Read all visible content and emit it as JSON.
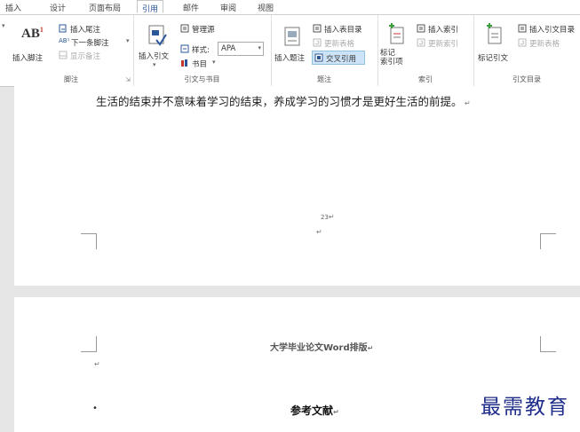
{
  "tabs": [
    "插入",
    "设计",
    "页面布局",
    "引用",
    "邮件",
    "审阅",
    "视图"
  ],
  "ribbon": {
    "footnotes": {
      "insert_footnote": "插入脚注",
      "insert_endnote": "插入尾注",
      "next_footnote": "下一条脚注",
      "show_notes": "显示备注",
      "group_label": "脚注"
    },
    "citations": {
      "insert_citation": "插入引文",
      "manage_sources": "管理源",
      "style_label": "样式:",
      "style_value": "APA",
      "bibliography": "书目",
      "group_label": "引文与书目"
    },
    "captions": {
      "insert_caption": "插入题注",
      "insert_table_of_figures": "插入表目录",
      "update_table": "更新表格",
      "cross_reference": "交叉引用",
      "group_label": "题注"
    },
    "index": {
      "mark_entry": "标记\n索引项",
      "insert_index": "插入索引",
      "update_index": "更新索引",
      "group_label": "索引"
    },
    "authorities": {
      "mark_citation": "标记引文",
      "insert_table_of_authorities": "插入引文目录",
      "update_table": "更新表格",
      "group_label": "引文目录"
    }
  },
  "document": {
    "page1_text": "生活的结束并不意味着学习的结束，养成学习的习惯才是更好生活的前提。",
    "page_number": "23",
    "page2_header": "大学毕业论文Word排版",
    "page2_heading": "参考文献",
    "bullet": "•"
  },
  "watermark": "最需教育",
  "colors": {
    "accent": "#2b579a",
    "ribbon_bg": "#ffffff",
    "canvas_bg": "#e6e6e6",
    "watermark": "#1f2d8a"
  }
}
